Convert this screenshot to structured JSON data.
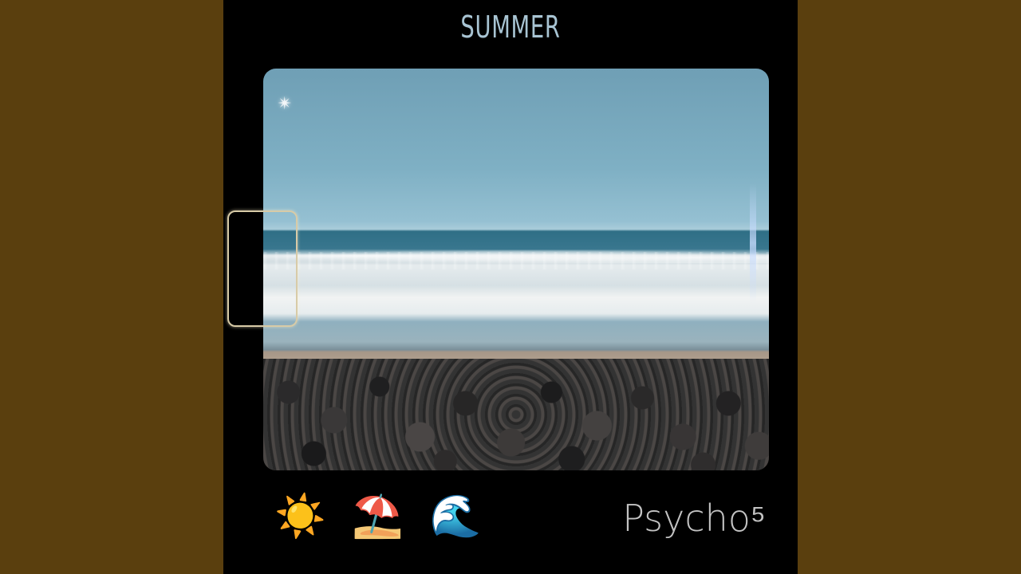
{
  "cover": {
    "title": "SUMMER",
    "artist": "Psycho⁵",
    "emojis": [
      "☀️",
      "⛱️",
      "🌊"
    ],
    "flare_glyph": "✴"
  },
  "colors": {
    "background": "#5a3f0e",
    "cover_bg": "#000000",
    "title_color": "#a8c4d3",
    "artist_color": "#c3c3c3",
    "viewfinder_color": "#d8cba7"
  }
}
